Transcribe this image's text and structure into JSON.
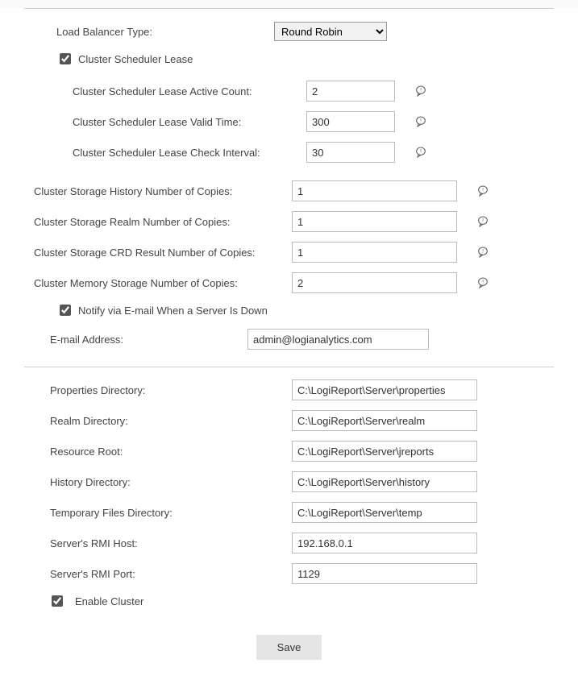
{
  "section1": {
    "load_balancer_type_label": "Load Balancer Type:",
    "load_balancer_type_value": "Round Robin",
    "cluster_scheduler_lease_label": "Cluster Scheduler Lease",
    "lease_active_count_label": "Cluster Scheduler Lease Active Count:",
    "lease_active_count_value": "2",
    "lease_valid_time_label": "Cluster Scheduler Lease Valid Time:",
    "lease_valid_time_value": "300",
    "lease_check_interval_label": "Cluster Scheduler Lease Check Interval:",
    "lease_check_interval_value": "30",
    "storage_history_label": "Cluster Storage History Number of Copies:",
    "storage_history_value": "1",
    "storage_realm_label": "Cluster Storage Realm Number of Copies:",
    "storage_realm_value": "1",
    "storage_crd_label": "Cluster Storage CRD Result Number of Copies:",
    "storage_crd_value": "1",
    "memory_storage_label": "Cluster Memory Storage Number of Copies:",
    "memory_storage_value": "2",
    "notify_email_label": "Notify via E-mail When a Server Is Down",
    "email_address_label": "E-mail Address:",
    "email_address_value": "admin@logianalytics.com"
  },
  "section2": {
    "properties_dir_label": "Properties Directory:",
    "properties_dir_value": "C:\\LogiReport\\Server\\properties",
    "realm_dir_label": "Realm Directory:",
    "realm_dir_value": "C:\\LogiReport\\Server\\realm",
    "resource_root_label": "Resource Root:",
    "resource_root_value": "C:\\LogiReport\\Server\\jreports",
    "history_dir_label": "History Directory:",
    "history_dir_value": "C:\\LogiReport\\Server\\history",
    "temp_dir_label": "Temporary Files Directory:",
    "temp_dir_value": "C:\\LogiReport\\Server\\temp",
    "rmi_host_label": "Server's RMI Host:",
    "rmi_host_value": "192.168.0.1",
    "rmi_port_label": "Server's RMI Port:",
    "rmi_port_value": "1129",
    "enable_cluster_label": "Enable Cluster"
  },
  "actions": {
    "save_label": "Save"
  }
}
